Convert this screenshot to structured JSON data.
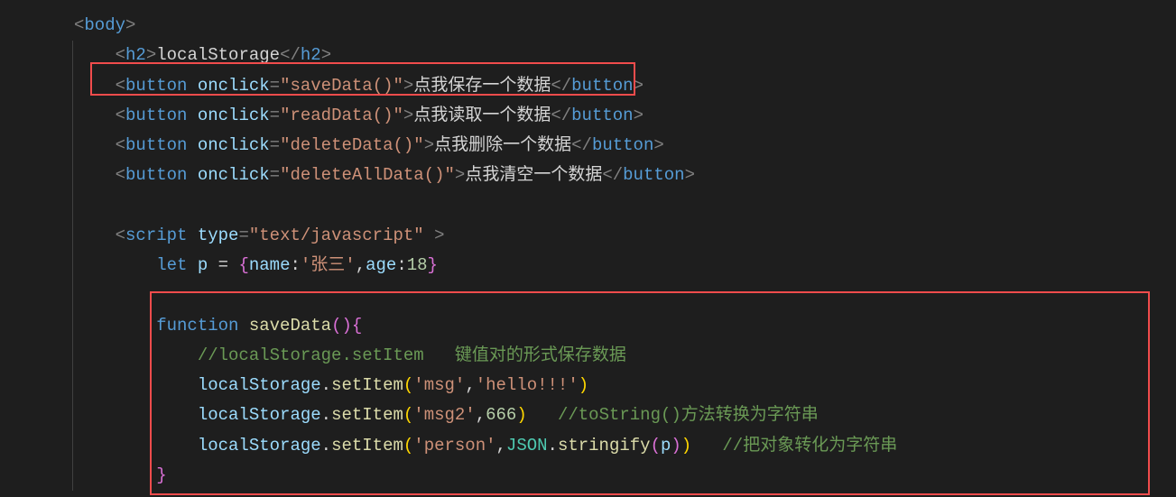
{
  "code": {
    "body_open": "<body>",
    "h2_open": "<h2>",
    "h2_text": "localStorage",
    "h2_close": "</h2>",
    "btn1": {
      "tag": "button",
      "attr": "onclick",
      "val": "\"saveData()\"",
      "text": "点我保存一个数据"
    },
    "btn2": {
      "tag": "button",
      "attr": "onclick",
      "val": "\"readData()\"",
      "text": "点我读取一个数据"
    },
    "btn3": {
      "tag": "button",
      "attr": "onclick",
      "val": "\"deleteData()\"",
      "text": "点我删除一个数据"
    },
    "btn4": {
      "tag": "button",
      "attr": "onclick",
      "val": "\"deleteAllData()\"",
      "text": "点我清空一个数据"
    },
    "script_open_tag": "script",
    "script_attr": "type",
    "script_val": "\"text/javascript\"",
    "let_kw": "let",
    "p_var": "p",
    "eq": "=",
    "obj_open": "{",
    "name_key": "name",
    "name_val": "'张三'",
    "age_key": "age",
    "age_val": "18",
    "obj_close": "}",
    "fn_kw": "function",
    "fn_name": "saveData",
    "fn_paren": "()",
    "fn_brace": "{",
    "comment1": "//localStorage.setItem   键值对的形式保存数据",
    "ls": "localStorage",
    "setItem": "setItem",
    "msg": "'msg'",
    "hello": "'hello!!!'",
    "msg2": "'msg2'",
    "num666": "666",
    "comment2": "//toString()方法转换为字符串",
    "person": "'person'",
    "json": "JSON",
    "stringify": "stringify",
    "p_arg": "p",
    "comment3": "//把对象转化为字符串",
    "fn_brace_close": "}"
  }
}
